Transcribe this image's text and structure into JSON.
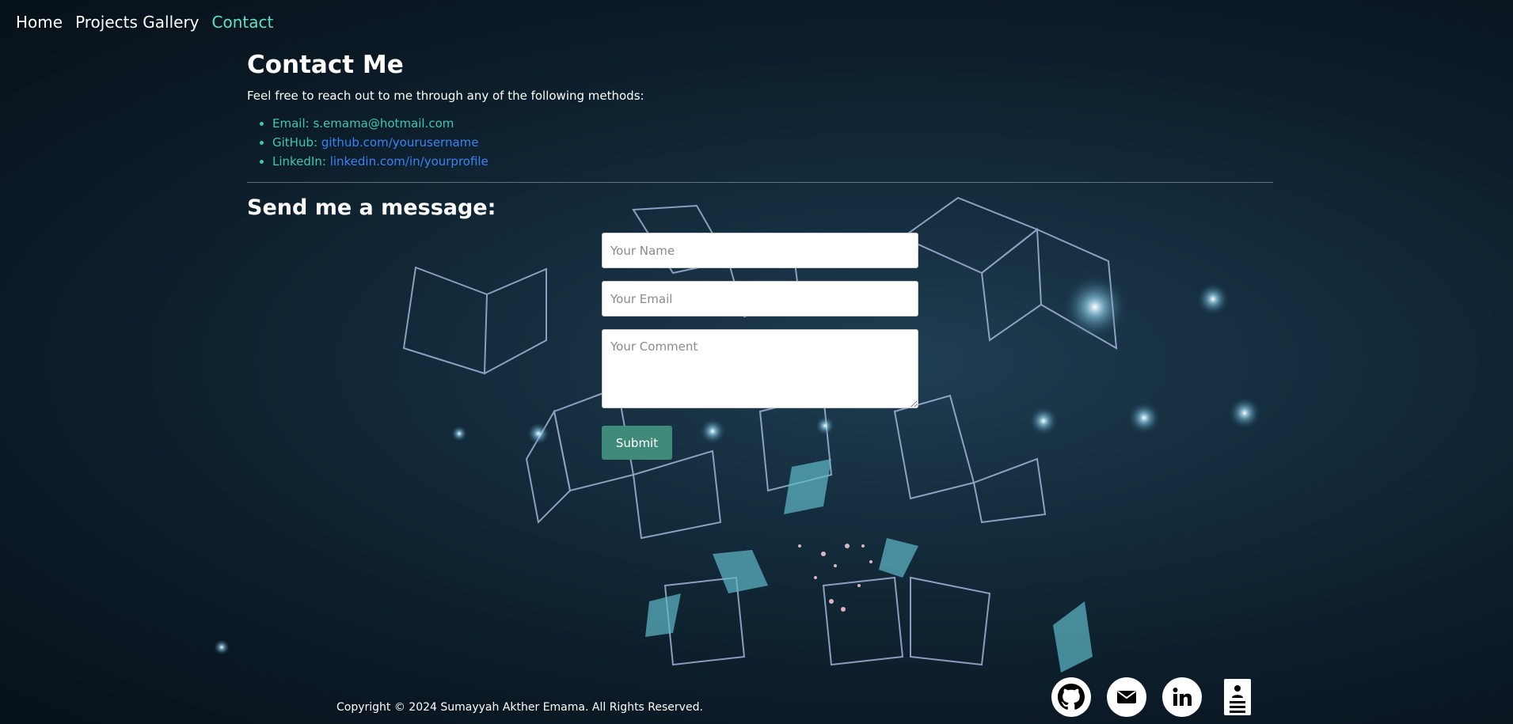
{
  "nav": {
    "items": [
      {
        "label": "Home"
      },
      {
        "label": "Projects Gallery"
      },
      {
        "label": "Contact"
      }
    ]
  },
  "contact": {
    "title": "Contact Me",
    "intro": "Feel free to reach out to me through any of the following methods:",
    "methods": [
      {
        "prefix": "Email: ",
        "value": "s.emama@hotmail.com"
      },
      {
        "prefix": "GitHub: ",
        "value": "github.com/yourusername"
      },
      {
        "prefix": "LinkedIn: ",
        "value": "linkedin.com/in/yourprofile"
      }
    ]
  },
  "form": {
    "heading": "Send me a message:",
    "name_placeholder": "Your Name",
    "email_placeholder": "Your Email",
    "comment_placeholder": "Your Comment",
    "submit_label": "Submit"
  },
  "footer": {
    "copyright": "Copyright © 2024 Sumayyah Akther Emama. All Rights Reserved.",
    "icons": [
      "github-icon",
      "mail-icon",
      "linkedin-icon",
      "resume-icon"
    ]
  },
  "colors": {
    "accent": "#5ee0c8",
    "list_text": "#3fc7b0",
    "link": "#3b82f6",
    "submit_bg": "#3f8a78"
  }
}
